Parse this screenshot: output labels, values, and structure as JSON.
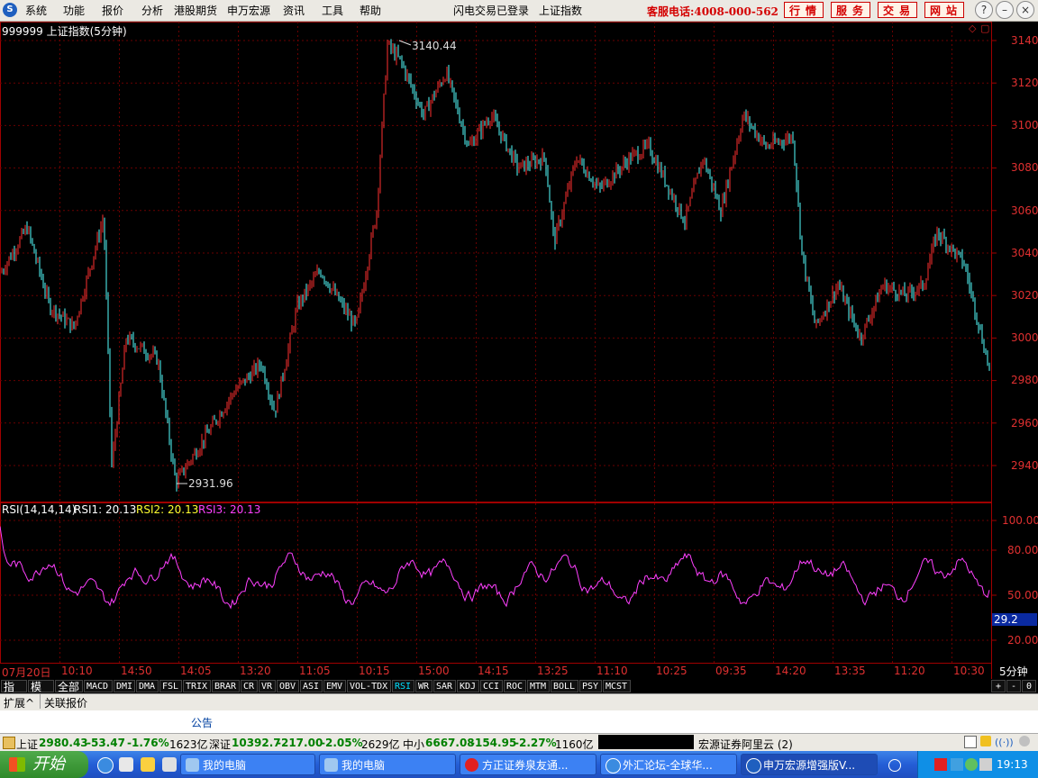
{
  "menu": [
    "系统",
    "功能",
    "报价",
    "分析",
    "港股期货",
    "申万宏源",
    "资讯",
    "工具",
    "帮助"
  ],
  "login_status": "闪电交易已登录",
  "quote_name": "上证指数",
  "hotline": "客服电话:4008-000-562",
  "top_buttons": [
    "行情",
    "服务",
    "交易",
    "网站"
  ],
  "window_buttons": [
    "?",
    "–",
    "□",
    "×"
  ],
  "chart_title": "999999 上证指数(5分钟)",
  "price_axis": [
    "3140",
    "3120",
    "3100",
    "3080",
    "3060",
    "3040",
    "3020",
    "3000",
    "2980",
    "2960",
    "2940"
  ],
  "annotations": {
    "high": "3140.44",
    "low": "2931.96"
  },
  "rsi": {
    "title": "RSI(14,14,14)",
    "rsi1": "RSI1: 20.13",
    "rsi2": "RSI2: 20.13",
    "rsi3": "RSI3: 20.13",
    "axis": [
      "100.00",
      "80.00",
      "50.00",
      "20.00"
    ],
    "current": "29.2"
  },
  "time_axis": [
    "07月20日",
    "10:10",
    "14:50",
    "14:05",
    "13:20",
    "11:05",
    "10:15",
    "15:00",
    "14:15",
    "13:25",
    "11:10",
    "10:25",
    "09:35",
    "14:20",
    "13:35",
    "11:20",
    "10:30"
  ],
  "period": "5分钟",
  "indicator_tabs": [
    "指标",
    "模板",
    "全部",
    "MACD",
    "DMI",
    "DMA",
    "FSL",
    "TRIX",
    "BRAR",
    "CR",
    "VR",
    "OBV",
    "ASI",
    "EMV",
    "VOL-TDX",
    "RSI",
    "WR",
    "SAR",
    "KDJ",
    "CCI",
    "ROC",
    "MTM",
    "BOLL",
    "PSY",
    "MCST"
  ],
  "tab_controls": [
    "+",
    "-",
    "0"
  ],
  "row2_tabs": [
    "扩展^",
    "关联报价"
  ],
  "announcement": "公告",
  "status": {
    "sh_label": "上证",
    "sh_value": "2980.43",
    "sh_change": "-53.47",
    "sh_pct": "-1.76%",
    "sh_amount": "1623亿",
    "sz_label": "深证",
    "sz_value": "10392.7",
    "sz_change": "-217.00",
    "sz_pct": "-2.05%",
    "sz_amount": "2629亿",
    "zx_label": "中小",
    "zx_value": "6667.08",
    "zx_change": "-154.95",
    "zx_pct": "-2.27%",
    "zx_amount": "1160亿",
    "server": "宏源证券阿里云 (2)"
  },
  "taskbar": {
    "start": "开始",
    "tasks": [
      "我的电脑",
      "我的电脑",
      "方正证券泉友通...",
      "外汇论坛-全球华...",
      "申万宏源增强版V..."
    ],
    "clock": "19:13"
  },
  "colors": {
    "up": "#ff3030",
    "down": "#54ffff",
    "rsi": "#ff40ff",
    "grid": "#6a0000"
  }
}
